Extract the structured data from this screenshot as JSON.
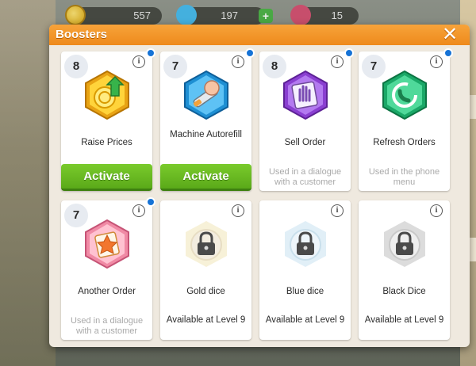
{
  "topbar": {
    "coins": "557",
    "gems": "197",
    "rubies": "15"
  },
  "dialog": {
    "title": "Boosters",
    "close_icon": "close-icon"
  },
  "cards": [
    {
      "count": "8",
      "label": "Raise Prices",
      "icon": "raise-prices-icon",
      "action": "Activate"
    },
    {
      "count": "7",
      "label": "Machine Autorefill",
      "icon": "machine-autorefill-icon",
      "action": "Activate"
    },
    {
      "count": "8",
      "label": "Sell Order",
      "icon": "sell-order-icon",
      "desc": "Used in a dialogue with a customer"
    },
    {
      "count": "7",
      "label": "Refresh Orders",
      "icon": "refresh-orders-icon",
      "desc": "Used in the phone menu"
    },
    {
      "count": "7",
      "label": "Another Order",
      "icon": "another-order-icon",
      "desc": "Used in a dialogue with a customer"
    },
    {
      "label": "Gold dice",
      "icon": "gold-dice-lock-icon",
      "level": "Available at Level 9"
    },
    {
      "label": "Blue dice",
      "icon": "blue-dice-lock-icon",
      "level": "Available at Level 9"
    },
    {
      "label": "Black Dice",
      "icon": "black-dice-lock-icon",
      "level": "Available at Level 9"
    }
  ],
  "colors": {
    "header": "#ee8a1c",
    "activate": "#5aa919",
    "notification_dot": "#1673d6"
  }
}
